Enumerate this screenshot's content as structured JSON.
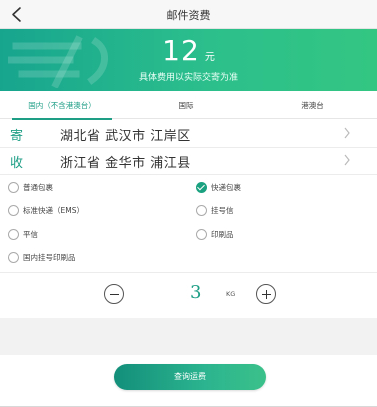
{
  "header": {
    "title": "邮件资费",
    "back_icon": "chevron-left-icon"
  },
  "hero": {
    "price": "12",
    "unit": "元",
    "note": "具体费用以实际交寄为准",
    "colors": {
      "start": "#17a58e",
      "end": "#33c682"
    }
  },
  "tabs": [
    {
      "label": "国内（不含港澳台）",
      "active": true
    },
    {
      "label": "国际",
      "active": false
    },
    {
      "label": "港澳台",
      "active": false
    }
  ],
  "address": {
    "from": {
      "tag": "寄",
      "value": "湖北省 武汉市 江岸区"
    },
    "to": {
      "tag": "收",
      "value": "浙江省 金华市 浦江县"
    }
  },
  "options": [
    {
      "label": "普通包裹",
      "checked": false
    },
    {
      "label": "快递包裹",
      "checked": true
    },
    {
      "label": "标准快递（EMS）",
      "checked": false
    },
    {
      "label": "挂号信",
      "checked": false
    },
    {
      "label": "平信",
      "checked": false
    },
    {
      "label": "印刷品",
      "checked": false
    },
    {
      "label": "国内挂号印刷品",
      "checked": false
    }
  ],
  "weight": {
    "value": "3",
    "unit": "KG"
  },
  "cta": {
    "label": "查询运费",
    "color": "#1d9e85"
  }
}
